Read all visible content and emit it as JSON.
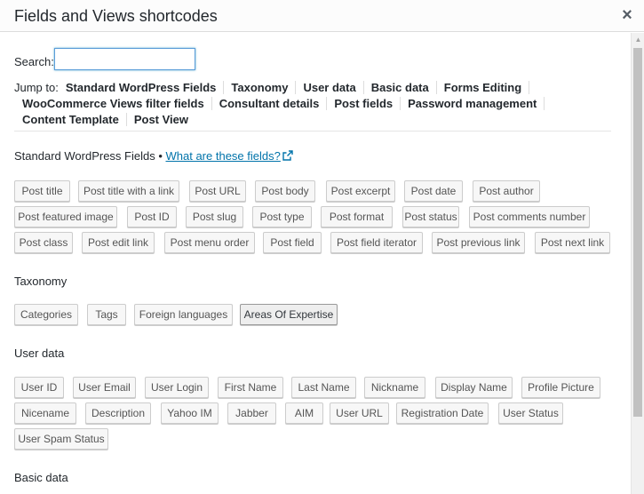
{
  "dialog": {
    "title": "Fields and Views shortcodes",
    "close_symbol": "×"
  },
  "search": {
    "label": "Search:",
    "value": ""
  },
  "jump": {
    "label": "Jump to:",
    "links": [
      "Standard WordPress Fields",
      "Taxonomy",
      "User data",
      "Basic data",
      "Forms Editing",
      "WooCommerce Views filter fields",
      "Consultant details",
      "Post fields",
      "Password management",
      "Content Template",
      "Post View"
    ]
  },
  "sections": {
    "standard": {
      "title": "Standard WordPress Fields",
      "separator": " • ",
      "help_link": "What are these fields?",
      "buttons": [
        "Post title",
        "Post title with a link",
        "Post URL",
        "Post body",
        "Post excerpt",
        "Post date",
        "Post author",
        "Post featured image",
        "Post ID",
        "Post slug",
        "Post type",
        "Post format",
        "Post status",
        "Post comments number",
        "Post class",
        "Post edit link",
        "Post menu order",
        "Post field",
        "Post field iterator",
        "Post previous link",
        "Post next link"
      ]
    },
    "taxonomy": {
      "title": "Taxonomy",
      "buttons": [
        "Categories",
        "Tags",
        "Foreign languages",
        "Areas Of Expertise"
      ]
    },
    "user": {
      "title": "User data",
      "buttons": [
        "User ID",
        "User Email",
        "User Login",
        "First Name",
        "Last Name",
        "Nickname",
        "Display Name",
        "Profile Picture",
        "Nicename",
        "Description",
        "Yahoo IM",
        "Jabber",
        "AIM",
        "User URL",
        "Registration Date",
        "User Status",
        "User Spam Status"
      ]
    },
    "basic": {
      "title": "Basic data"
    }
  },
  "icons": {
    "close": "close-icon",
    "external": "external-link-icon"
  },
  "colors": {
    "link": "#0073aa",
    "focus": "#5b9dd9"
  }
}
